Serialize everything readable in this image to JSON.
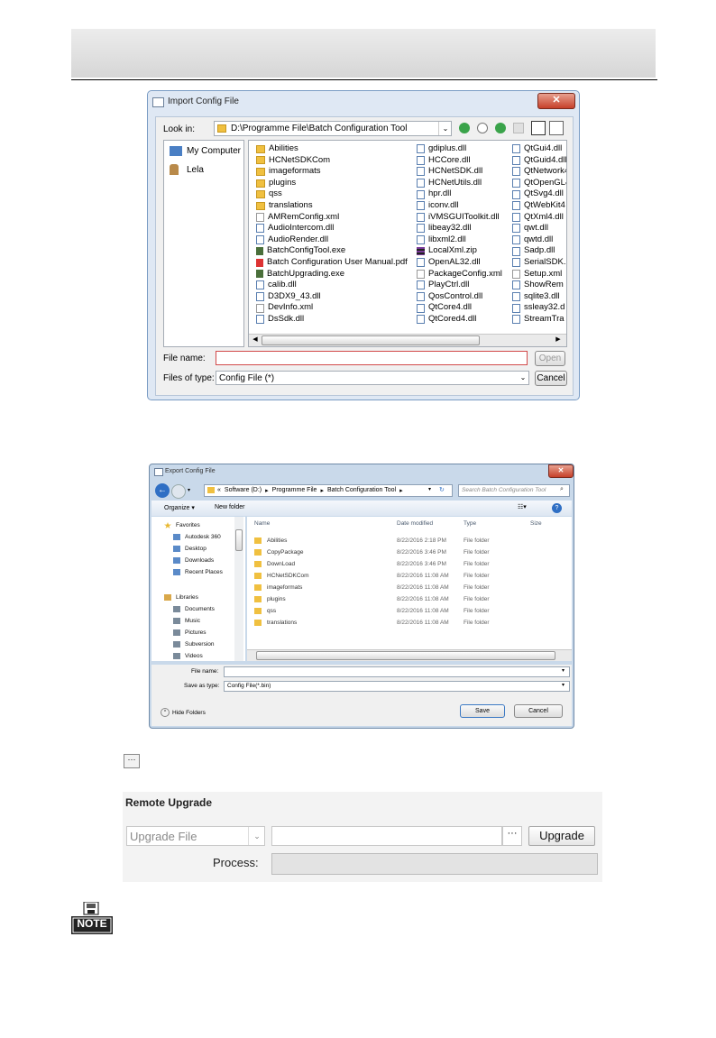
{
  "import_dialog": {
    "title": "Import Config File",
    "look_in_label": "Look in:",
    "path": "D:\\Programme File\\Batch Configuration Tool",
    "places": [
      "My Computer",
      "Lela"
    ],
    "files_col1": [
      {
        "name": "Abilities",
        "type": "folder"
      },
      {
        "name": "HCNetSDKCom",
        "type": "folder"
      },
      {
        "name": "imageformats",
        "type": "folder"
      },
      {
        "name": "plugins",
        "type": "folder"
      },
      {
        "name": "qss",
        "type": "folder"
      },
      {
        "name": "translations",
        "type": "folder"
      },
      {
        "name": "AMRemConfig.xml",
        "type": "xml"
      },
      {
        "name": "AudioIntercom.dll",
        "type": "file"
      },
      {
        "name": "AudioRender.dll",
        "type": "file"
      },
      {
        "name": "BatchConfigTool.exe",
        "type": "exe"
      },
      {
        "name": "Batch Configuration User Manual.pdf",
        "type": "pdf"
      },
      {
        "name": "BatchUpgrading.exe",
        "type": "exe"
      },
      {
        "name": "calib.dll",
        "type": "file"
      },
      {
        "name": "D3DX9_43.dll",
        "type": "file"
      },
      {
        "name": "DevInfo.xml",
        "type": "xml"
      },
      {
        "name": "DsSdk.dll",
        "type": "file"
      }
    ],
    "files_col2": [
      {
        "name": "gdiplus.dll",
        "type": "file"
      },
      {
        "name": "HCCore.dll",
        "type": "file"
      },
      {
        "name": "HCNetSDK.dll",
        "type": "file"
      },
      {
        "name": "HCNetUtils.dll",
        "type": "file"
      },
      {
        "name": "hpr.dll",
        "type": "file"
      },
      {
        "name": "iconv.dll",
        "type": "file"
      },
      {
        "name": "iVMSGUIToolkit.dll",
        "type": "file"
      },
      {
        "name": "libeay32.dll",
        "type": "file"
      },
      {
        "name": "libxml2.dll",
        "type": "file"
      },
      {
        "name": "LocalXml.zip",
        "type": "zip"
      },
      {
        "name": "OpenAL32.dll",
        "type": "file"
      },
      {
        "name": "PackageConfig.xml",
        "type": "xml"
      },
      {
        "name": "PlayCtrl.dll",
        "type": "file"
      },
      {
        "name": "QosControl.dll",
        "type": "file"
      },
      {
        "name": "QtCore4.dll",
        "type": "file"
      },
      {
        "name": "QtCored4.dll",
        "type": "file"
      }
    ],
    "files_col3": [
      {
        "name": "QtGui4.dll",
        "type": "file"
      },
      {
        "name": "QtGuid4.dll",
        "type": "file"
      },
      {
        "name": "QtNetwork4",
        "type": "file"
      },
      {
        "name": "QtOpenGL4",
        "type": "file"
      },
      {
        "name": "QtSvg4.dll",
        "type": "file"
      },
      {
        "name": "QtWebKit4",
        "type": "file"
      },
      {
        "name": "QtXml4.dll",
        "type": "file"
      },
      {
        "name": "qwt.dll",
        "type": "file"
      },
      {
        "name": "qwtd.dll",
        "type": "file"
      },
      {
        "name": "Sadp.dll",
        "type": "file"
      },
      {
        "name": "SerialSDK.",
        "type": "file"
      },
      {
        "name": "Setup.xml",
        "type": "xml"
      },
      {
        "name": "ShowRem",
        "type": "file"
      },
      {
        "name": "sqlite3.dll",
        "type": "file"
      },
      {
        "name": "ssleay32.d",
        "type": "file"
      },
      {
        "name": "StreamTra",
        "type": "file"
      }
    ],
    "file_name_label": "File name:",
    "file_name_value": "",
    "files_of_type_label": "Files of type:",
    "files_of_type_value": "Config File (*)",
    "open_label": "Open",
    "cancel_label": "Cancel"
  },
  "export_dialog": {
    "title": "Export Config File",
    "breadcrumb": [
      "«",
      "Software (D:)",
      "▸",
      "Programme File",
      "▸",
      "Batch Configuration Tool",
      "▸"
    ],
    "search_placeholder": "Search Batch Configuration Tool",
    "organize_label": "Organize ▾",
    "new_folder_label": "New folder",
    "nav": {
      "favorites_header": "Favorites",
      "favorites": [
        "Autodesk 360",
        "Desktop",
        "Downloads",
        "Recent Places"
      ],
      "libraries_header": "Libraries",
      "libraries": [
        "Documents",
        "Music",
        "Pictures",
        "Subversion",
        "Videos"
      ]
    },
    "columns": [
      "Name",
      "Date modified",
      "Type",
      "Size"
    ],
    "rows": [
      {
        "name": "Abilities",
        "date": "8/22/2016 2:18 PM",
        "type": "File folder"
      },
      {
        "name": "CopyPackage",
        "date": "8/22/2016 3:46 PM",
        "type": "File folder"
      },
      {
        "name": "DownLoad",
        "date": "8/22/2016 3:46 PM",
        "type": "File folder"
      },
      {
        "name": "HCNetSDKCom",
        "date": "8/22/2016 11:08 AM",
        "type": "File folder"
      },
      {
        "name": "imageformats",
        "date": "8/22/2016 11:08 AM",
        "type": "File folder"
      },
      {
        "name": "plugins",
        "date": "8/22/2016 11:08 AM",
        "type": "File folder"
      },
      {
        "name": "qss",
        "date": "8/22/2016 11:08 AM",
        "type": "File folder"
      },
      {
        "name": "translations",
        "date": "8/22/2016 11:08 AM",
        "type": "File folder"
      }
    ],
    "file_name_label": "File name:",
    "file_name_value": "",
    "save_as_type_label": "Save as type:",
    "save_as_type_value": "Config File(*.bin)",
    "hide_folders_label": "Hide Folders",
    "save_label": "Save",
    "cancel_label": "Cancel"
  },
  "browse_button_glyph": "···",
  "remote_upgrade": {
    "title": "Remote Upgrade",
    "select_value": "Upgrade File",
    "browse_glyph": "···",
    "upgrade_label": "Upgrade",
    "process_label": "Process:",
    "progress": 0
  },
  "note_label": "NOTE",
  "colors": {
    "accent_blue": "#3a78c3",
    "close_red": "#c6402a",
    "folder_yellow": "#f0c040"
  }
}
